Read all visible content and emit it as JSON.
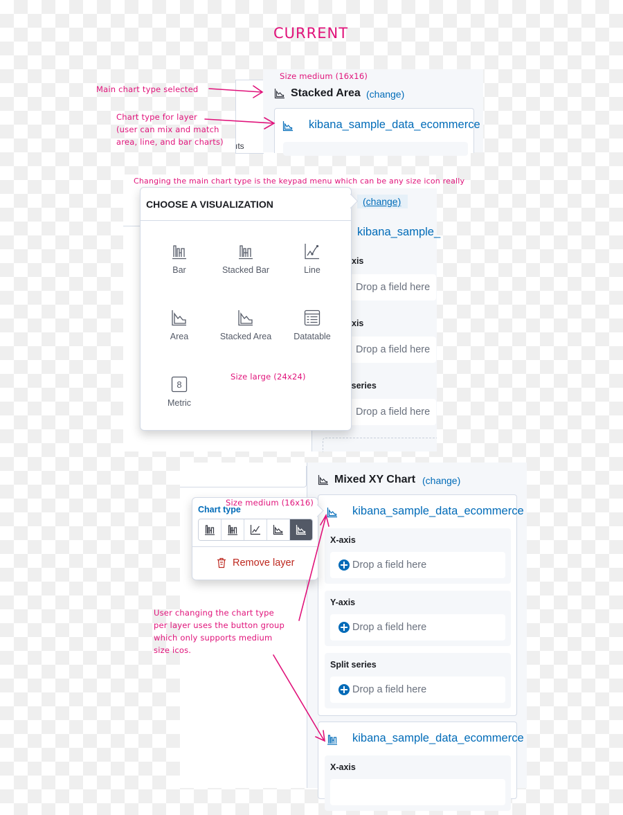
{
  "heading": "CURRENT",
  "annotations": {
    "size_medium_1": "Size medium (16x16)",
    "main_chart_type": "Main chart type selected",
    "layer_chart_type": [
      "Chart type for layer",
      "(user can mix and match",
      "area, line, and bar charts)"
    ],
    "keypad_note": "Changing the main chart type is the keypad menu which can be any size icon really",
    "size_large": "Size large (24x24)",
    "size_medium_2": "Size medium (16x16)",
    "button_group_note": [
      "User changing the chart type",
      "per layer uses the button group",
      "which only supports medium",
      "size icos."
    ]
  },
  "section1": {
    "chart_title": "Stacked Area",
    "change_link": "(change)",
    "layer_title": "kibana_sample_data_ecommerce",
    "partial_left_text": "ıts",
    "chart_icon": "area-chart-icon"
  },
  "section2": {
    "popover_title": "CHOOSE A VISUALIZATION",
    "change_link": "(change)",
    "layer_title": "kibana_sample_",
    "visualizations": [
      {
        "label": "Bar",
        "icon": "bar-chart-icon"
      },
      {
        "label": "Stacked Bar",
        "icon": "stacked-bar-chart-icon"
      },
      {
        "label": "Line",
        "icon": "line-chart-icon"
      },
      {
        "label": "Area",
        "icon": "area-chart-icon"
      },
      {
        "label": "Stacked Area",
        "icon": "stacked-area-chart-icon"
      },
      {
        "label": "Datatable",
        "icon": "datatable-icon"
      },
      {
        "label": "Metric",
        "icon": "metric-icon"
      }
    ],
    "groups": [
      {
        "label": "xis",
        "drop": "Drop a field here"
      },
      {
        "label": "xis",
        "drop": "Drop a field here"
      },
      {
        "label": ": series",
        "drop": "Drop a field here"
      }
    ]
  },
  "section3": {
    "chart_title": "Mixed XY Chart",
    "change_link": "(change)",
    "chart_type_label": "Chart type",
    "chart_type_buttons": [
      {
        "name": "bar",
        "icon": "bar-chart-icon",
        "selected": false
      },
      {
        "name": "stacked-bar",
        "icon": "stacked-bar-chart-icon",
        "selected": false
      },
      {
        "name": "line",
        "icon": "line-chart-icon",
        "selected": false
      },
      {
        "name": "area",
        "icon": "area-chart-icon",
        "selected": false
      },
      {
        "name": "stacked-area",
        "icon": "stacked-area-chart-icon",
        "selected": true
      }
    ],
    "remove_layer": "Remove layer",
    "layers": [
      {
        "title": "kibana_sample_data_ecommerce",
        "icon": "area-chart-icon",
        "groups": [
          {
            "label": "X-axis",
            "drop": "Drop a field here"
          },
          {
            "label": "Y-axis",
            "drop": "Drop a field here"
          },
          {
            "label": "Split series",
            "drop": "Drop a field here"
          }
        ]
      },
      {
        "title": "kibana_sample_data_ecommerce",
        "icon": "bar-chart-icon",
        "groups": [
          {
            "label": "X-axis"
          }
        ]
      }
    ]
  },
  "colors": {
    "annotation": "#e0127a",
    "link": "#006bb8",
    "danger": "#bd271e",
    "selected_button": "#535966"
  }
}
